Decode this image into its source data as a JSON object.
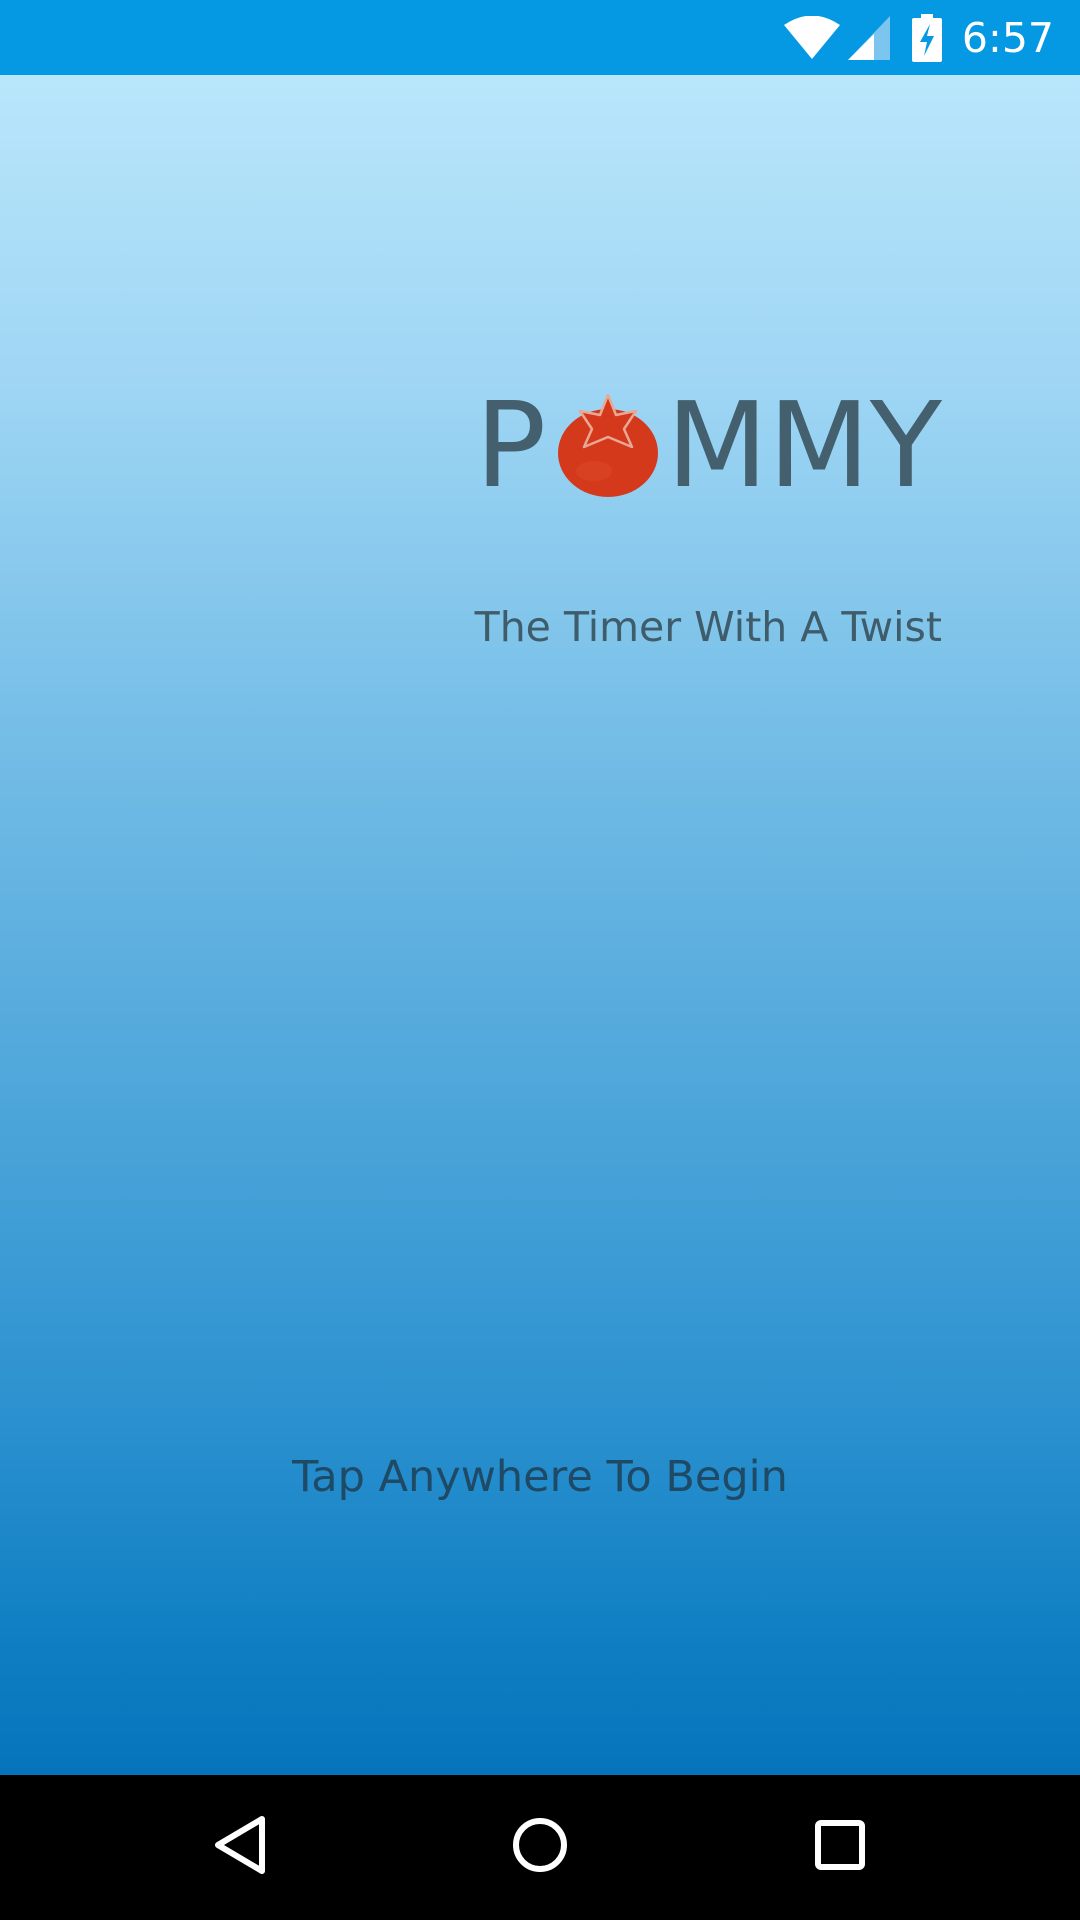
{
  "status_bar": {
    "time": "6:57",
    "icons": [
      "wifi-icon",
      "cell-signal-icon",
      "battery-charging-icon"
    ]
  },
  "app": {
    "logo": {
      "letters_before": "P",
      "letters_after": "MMY",
      "icon": "tomato-icon"
    },
    "tagline": "The Timer With A Twist",
    "prompt": "Tap Anywhere To Begin"
  },
  "colors": {
    "status_bar": "#0499e2",
    "gradient_top": "#b9e6fb",
    "gradient_bottom": "#0674bb",
    "logo_text": "#44606e",
    "tomato": "#d4391c",
    "prompt_text": "#1f4a66",
    "nav_bar": "#000000"
  },
  "nav_bar": {
    "buttons": [
      "back-icon",
      "home-icon",
      "recents-icon"
    ]
  }
}
